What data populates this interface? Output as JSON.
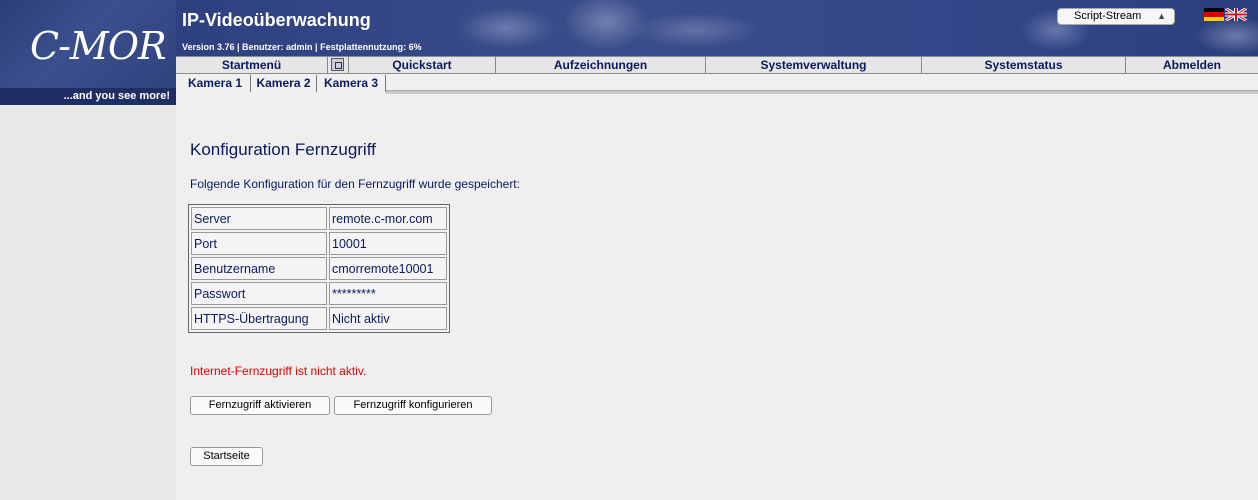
{
  "brand": {
    "logo": "C-MOR",
    "tagline": "...and you see more!"
  },
  "header": {
    "title": "IP-Videoüberwachung",
    "subtitle": "Version 3.76 | Benutzer: admin | Festplattennutzung: 6%",
    "stream_select": "Script-Stream",
    "languages": [
      "de",
      "en"
    ]
  },
  "nav": {
    "start": "Startmenü",
    "quickstart": "Quickstart",
    "recordings": "Aufzeichnungen",
    "system_admin": "Systemverwaltung",
    "system_status": "Systemstatus",
    "logout": "Abmelden"
  },
  "camera_tabs": [
    "Kamera 1",
    "Kamera 2",
    "Kamera 3"
  ],
  "main": {
    "title": "Konfiguration Fernzugriff",
    "intro": "Folgende Konfiguration für den Fernzugriff wurde gespeichert:",
    "config": [
      {
        "key": "Server",
        "value": "remote.c-mor.com"
      },
      {
        "key": "Port",
        "value": "10001"
      },
      {
        "key": "Benutzername",
        "value": "cmorremote10001"
      },
      {
        "key": "Passwort",
        "value": "*********"
      },
      {
        "key": "HTTPS-Übertragung",
        "value": "Nicht aktiv"
      }
    ],
    "warning": "Internet-Fernzugriff ist nicht aktiv.",
    "activate_button": "Fernzugriff aktivieren",
    "configure_button": "Fernzugriff konfigurieren",
    "home_button": "Startseite"
  },
  "colors": {
    "header_blue": "#2e4080",
    "nav_text": "#0a1a5e",
    "warning_red": "#e00000"
  }
}
